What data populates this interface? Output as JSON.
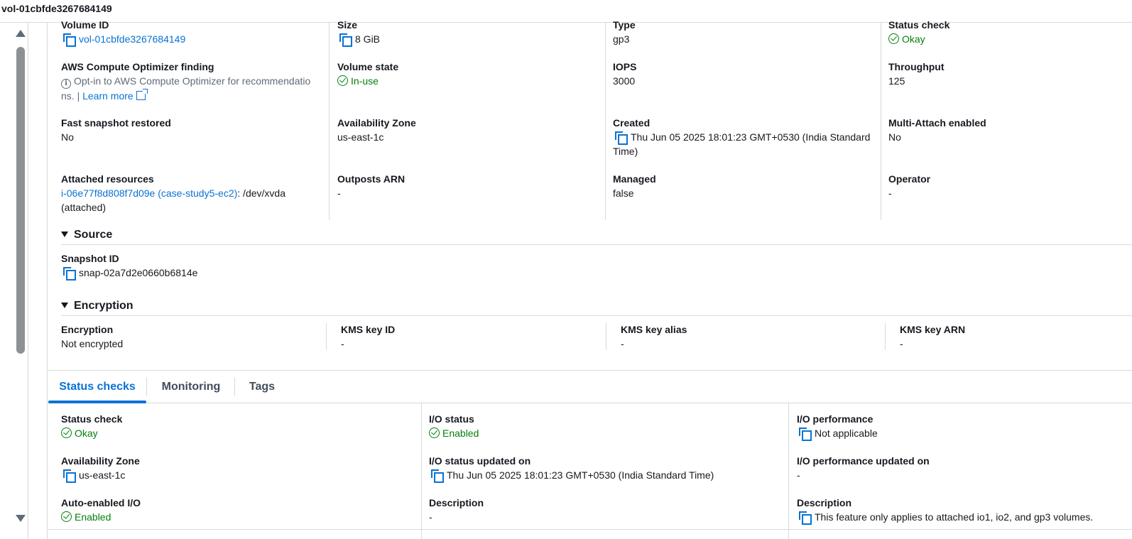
{
  "header": {
    "title": "vol-01cbfde3267684149"
  },
  "details": {
    "volume_id": {
      "label": "Volume ID",
      "value": "vol-01cbfde3267684149"
    },
    "size": {
      "label": "Size",
      "value": "8 GiB"
    },
    "type": {
      "label": "Type",
      "value": "gp3"
    },
    "status_check": {
      "label": "Status check",
      "value": "Okay"
    },
    "optimizer": {
      "label": "AWS Compute Optimizer finding",
      "value_line1": "Opt-in to AWS Compute Optimizer for recommendatio",
      "value_line2": "ns. |",
      "link": "Learn more"
    },
    "volume_state": {
      "label": "Volume state",
      "value": "In-use"
    },
    "iops": {
      "label": "IOPS",
      "value": "3000"
    },
    "throughput": {
      "label": "Throughput",
      "value": "125"
    },
    "fast_snapshot": {
      "label": "Fast snapshot restored",
      "value": "No"
    },
    "availability_zone": {
      "label": "Availability Zone",
      "value": "us-east-1c"
    },
    "created": {
      "label": "Created",
      "value_line1": "Thu Jun 05 2025 18:01:23 GMT+0530 (India Standard",
      "value_line2": "Time)"
    },
    "multi_attach": {
      "label": "Multi-Attach enabled",
      "value": "No"
    },
    "attached": {
      "label": "Attached resources",
      "link": "i-06e77f8d808f7d09e (case-study5-ec2)",
      "suffix": ": /dev/xvda",
      "line2": "(attached)"
    },
    "outposts": {
      "label": "Outposts ARN",
      "value": "-"
    },
    "managed": {
      "label": "Managed",
      "value": "false"
    },
    "operator": {
      "label": "Operator",
      "value": "-"
    }
  },
  "source": {
    "heading": "Source",
    "snapshot_label": "Snapshot ID",
    "snapshot_value": "snap-02a7d2e0660b6814e"
  },
  "encryption": {
    "heading": "Encryption",
    "encryption_label": "Encryption",
    "encryption_value": "Not encrypted",
    "kms_id_label": "KMS key ID",
    "kms_id_value": "-",
    "kms_alias_label": "KMS key alias",
    "kms_alias_value": "-",
    "kms_arn_label": "KMS key ARN",
    "kms_arn_value": "-"
  },
  "tabs": [
    {
      "label": "Status checks",
      "active": true
    },
    {
      "label": "Monitoring",
      "active": false
    },
    {
      "label": "Tags",
      "active": false
    }
  ],
  "status": {
    "status_check": {
      "label": "Status check",
      "value": "Okay"
    },
    "io_status": {
      "label": "I/O status",
      "value": "Enabled"
    },
    "io_performance": {
      "label": "I/O performance",
      "value": "Not applicable"
    },
    "availability_zone": {
      "label": "Availability Zone",
      "value": "us-east-1c"
    },
    "io_status_updated": {
      "label": "I/O status updated on",
      "value": "Thu Jun 05 2025 18:01:23 GMT+0530 (India Standard Time)"
    },
    "io_perf_updated": {
      "label": "I/O performance updated on",
      "value": "-"
    },
    "auto_enabled": {
      "label": "Auto-enabled I/O",
      "value": "Enabled"
    },
    "description_mid": {
      "label": "Description",
      "value": "-"
    },
    "description_right": {
      "label": "Description",
      "value": "This feature only applies to attached io1, io2, and gp3 volumes."
    }
  },
  "colors": {
    "link": "#0972d3",
    "success": "#037f0c",
    "border": "#d5dbdb",
    "text": "#16191f"
  }
}
